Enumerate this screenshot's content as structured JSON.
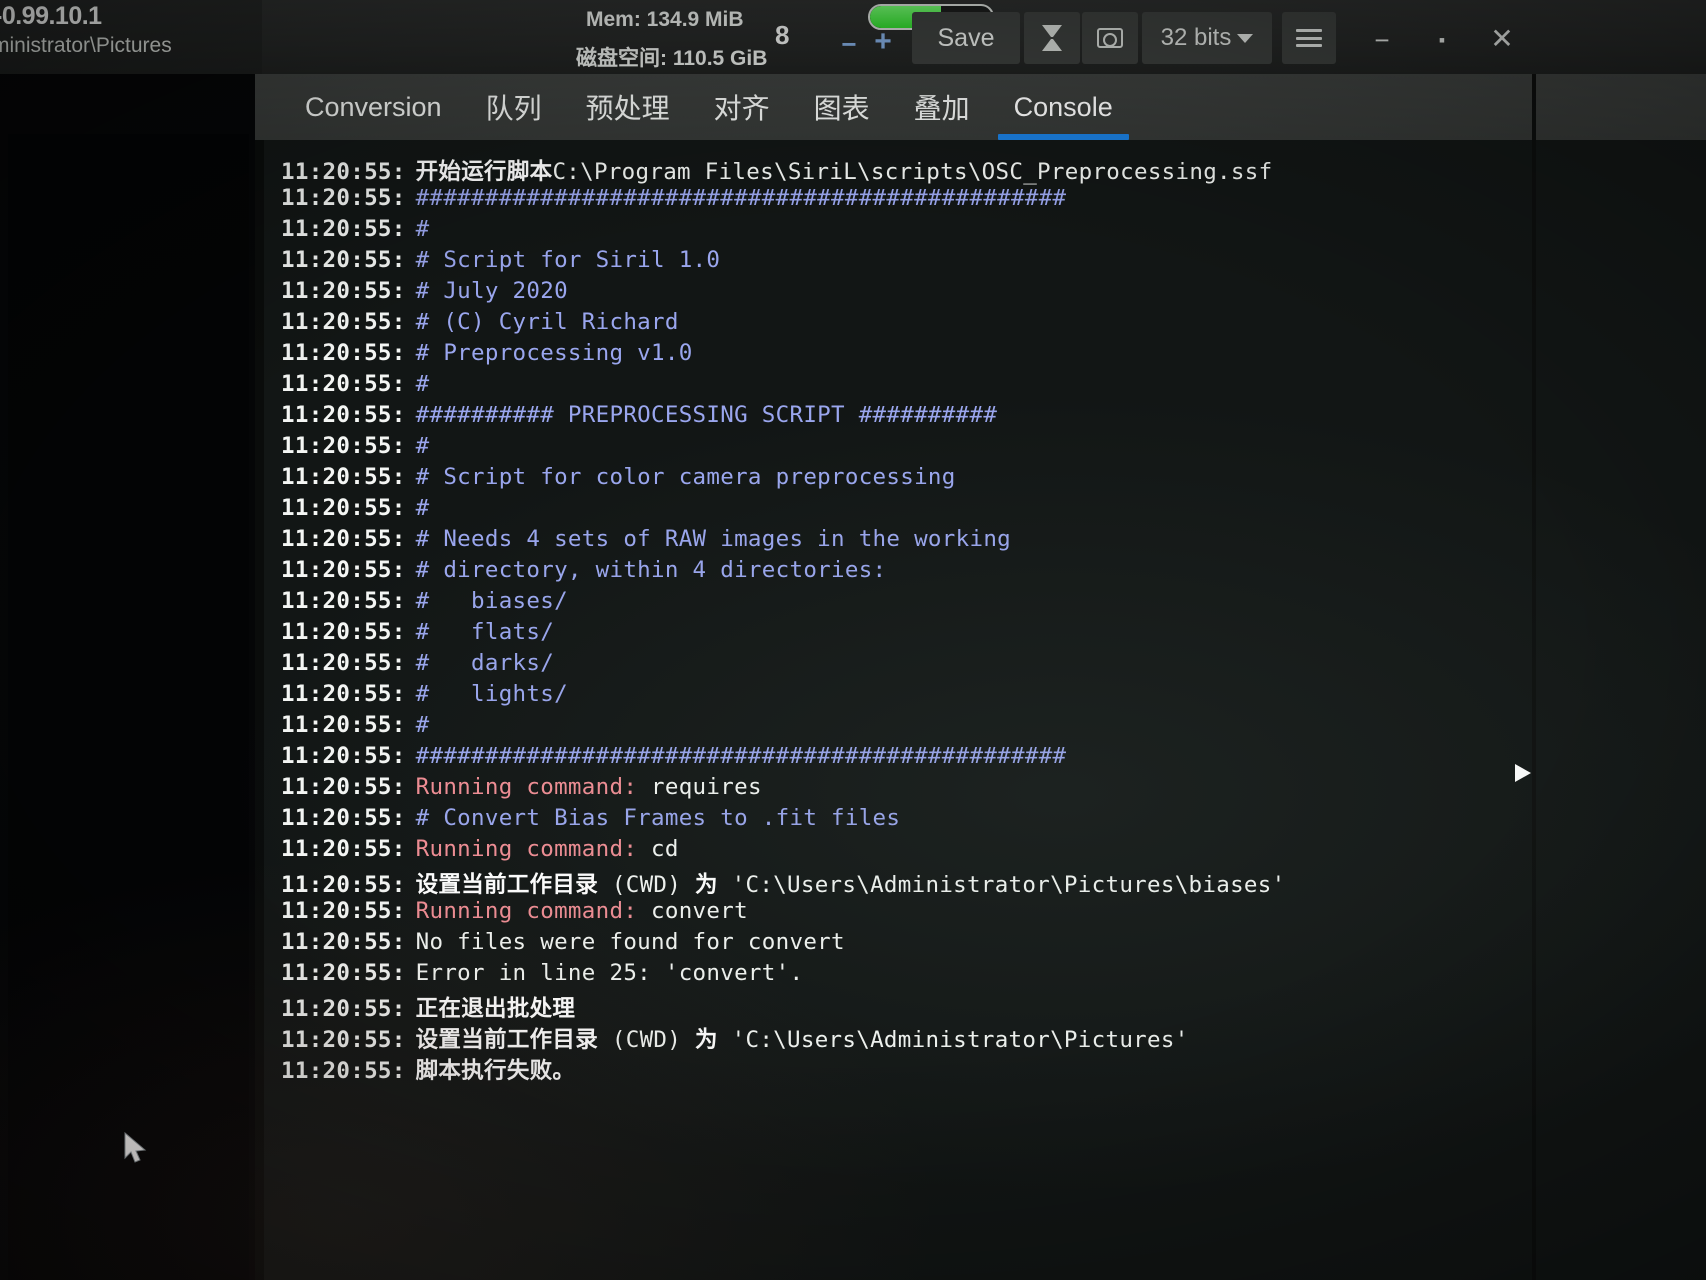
{
  "app": {
    "version_label": "-0.99.10.1",
    "working_path": "ministrator\\Pictures"
  },
  "topbar": {
    "memory": "Mem: 134.9 MiB",
    "disk": "磁盘空间: 110.5 GiB",
    "threads": "8",
    "progress_percent": 58,
    "minus_label": "−",
    "plus_label": "+",
    "save_label": "Save",
    "snapshot_icon": "hourglass-icon",
    "photo_icon": "camera-icon",
    "bit_depth": "32 bits",
    "hamburger_icon": "hamburger-icon",
    "minimize_label": "−",
    "maximize_label": "▪",
    "close_label": "✕",
    "accent_blue": "#1b7fe0",
    "progress_green": "#2fd12b"
  },
  "tabs": [
    {
      "label": "Conversion",
      "active": false
    },
    {
      "label": "队列",
      "active": false
    },
    {
      "label": "预处理",
      "active": false
    },
    {
      "label": "对齐",
      "active": false
    },
    {
      "label": "图表",
      "active": false
    },
    {
      "label": "叠加",
      "active": false
    },
    {
      "label": "Console",
      "active": true
    }
  ],
  "console": {
    "timestamp": "11:20:55:",
    "lines": [
      {
        "parts": [
          {
            "text": "开始运行脚本",
            "style": "cn"
          },
          {
            "text": "C:\\Program Files\\SiriL\\scripts\\OSC_Preprocessing.ssf",
            "style": "white"
          }
        ]
      },
      {
        "parts": [
          {
            "text": "###############################################",
            "style": "blue"
          }
        ]
      },
      {
        "parts": [
          {
            "text": "#",
            "style": "blue"
          }
        ]
      },
      {
        "parts": [
          {
            "text": "# Script for Siril 1.0",
            "style": "blue"
          }
        ]
      },
      {
        "parts": [
          {
            "text": "# July 2020",
            "style": "blue"
          }
        ]
      },
      {
        "parts": [
          {
            "text": "# (C) Cyril Richard",
            "style": "blue"
          }
        ]
      },
      {
        "parts": [
          {
            "text": "# Preprocessing v1.0",
            "style": "blue"
          }
        ]
      },
      {
        "parts": [
          {
            "text": "#",
            "style": "blue"
          }
        ]
      },
      {
        "parts": [
          {
            "text": "########## PREPROCESSING SCRIPT ##########",
            "style": "blue"
          }
        ]
      },
      {
        "parts": [
          {
            "text": "#",
            "style": "blue"
          }
        ]
      },
      {
        "parts": [
          {
            "text": "# Script for color camera preprocessing",
            "style": "blue"
          }
        ]
      },
      {
        "parts": [
          {
            "text": "#",
            "style": "blue"
          }
        ]
      },
      {
        "parts": [
          {
            "text": "# Needs 4 sets of RAW images in the working",
            "style": "blue"
          }
        ]
      },
      {
        "parts": [
          {
            "text": "# directory, within 4 directories:",
            "style": "blue"
          }
        ]
      },
      {
        "parts": [
          {
            "text": "#   biases/",
            "style": "blue"
          }
        ]
      },
      {
        "parts": [
          {
            "text": "#   flats/",
            "style": "blue"
          }
        ]
      },
      {
        "parts": [
          {
            "text": "#   darks/",
            "style": "blue"
          }
        ]
      },
      {
        "parts": [
          {
            "text": "#   lights/",
            "style": "blue"
          }
        ]
      },
      {
        "parts": [
          {
            "text": "#",
            "style": "blue"
          }
        ]
      },
      {
        "parts": [
          {
            "text": "###############################################",
            "style": "blue"
          }
        ]
      },
      {
        "parts": [
          {
            "text": "Running command: ",
            "style": "red"
          },
          {
            "text": "requires",
            "style": "white"
          }
        ]
      },
      {
        "parts": [
          {
            "text": "# Convert Bias Frames to .fit files",
            "style": "blue"
          }
        ]
      },
      {
        "parts": [
          {
            "text": "Running command: ",
            "style": "red"
          },
          {
            "text": "cd",
            "style": "white"
          }
        ]
      },
      {
        "parts": [
          {
            "text": "设置当前工作目录",
            "style": "cn"
          },
          {
            "text": " (CWD) ",
            "style": "white"
          },
          {
            "text": "为",
            "style": "cn"
          },
          {
            "text": " 'C:\\Users\\Administrator\\Pictures\\biases'",
            "style": "white"
          }
        ]
      },
      {
        "parts": [
          {
            "text": "Running command: ",
            "style": "red"
          },
          {
            "text": "convert",
            "style": "white"
          }
        ]
      },
      {
        "parts": [
          {
            "text": "No files were found for convert",
            "style": "white"
          }
        ]
      },
      {
        "parts": [
          {
            "text": "Error in line 25: 'convert'.",
            "style": "white"
          }
        ]
      },
      {
        "parts": [
          {
            "text": "正在退出批处理",
            "style": "cn"
          }
        ]
      },
      {
        "parts": [
          {
            "text": "设置当前工作目录",
            "style": "cn"
          },
          {
            "text": " (CWD) ",
            "style": "white"
          },
          {
            "text": "为",
            "style": "cn"
          },
          {
            "text": " 'C:\\Users\\Administrator\\Pictures'",
            "style": "white"
          }
        ]
      },
      {
        "parts": [
          {
            "text": "脚本执行失败。",
            "style": "cn"
          }
        ]
      }
    ]
  },
  "panels": {
    "image_panel_name": "image-preview-panel",
    "collapse_handle_icon": "triangle-right-icon",
    "cursor_icon": "mouse-pointer-icon"
  }
}
